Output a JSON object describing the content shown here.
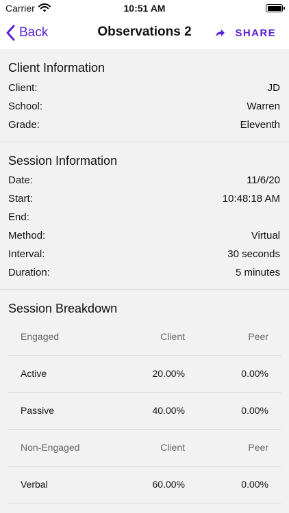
{
  "status_bar": {
    "carrier": "Carrier",
    "time": "10:51 AM"
  },
  "nav": {
    "back_label": "Back",
    "title": "Observations 2",
    "share_label": "SHARE"
  },
  "client_info": {
    "title": "Client Information",
    "rows": [
      {
        "label": "Client:",
        "value": "JD"
      },
      {
        "label": "School:",
        "value": "Warren"
      },
      {
        "label": "Grade:",
        "value": "Eleventh"
      }
    ]
  },
  "session_info": {
    "title": "Session Information",
    "rows": [
      {
        "label": "Date:",
        "value": "11/6/20"
      },
      {
        "label": "Start:",
        "value": "10:48:18 AM"
      },
      {
        "label": "End:",
        "value": ""
      },
      {
        "label": "Method:",
        "value": "Virtual"
      },
      {
        "label": "Interval:",
        "value": "30 seconds"
      },
      {
        "label": "Duration:",
        "value": "5 minutes"
      }
    ]
  },
  "breakdown": {
    "title": "Session Breakdown",
    "rows": [
      {
        "kind": "header",
        "name": "Engaged",
        "client": "Client",
        "peer": "Peer"
      },
      {
        "kind": "data",
        "name": "Active",
        "client": "20.00%",
        "peer": "0.00%"
      },
      {
        "kind": "data",
        "name": "Passive",
        "client": "40.00%",
        "peer": "0.00%"
      },
      {
        "kind": "header",
        "name": "Non-Engaged",
        "client": "Client",
        "peer": "Peer"
      },
      {
        "kind": "data",
        "name": "Verbal",
        "client": "60.00%",
        "peer": "0.00%"
      }
    ]
  },
  "colors": {
    "accent": "#5b21d6",
    "background": "#f2f2f2",
    "divider": "#dadada"
  },
  "icons": {
    "back": "chevron-left-icon",
    "share": "share-arrow-icon",
    "wifi": "wifi-icon",
    "battery": "battery-icon"
  }
}
